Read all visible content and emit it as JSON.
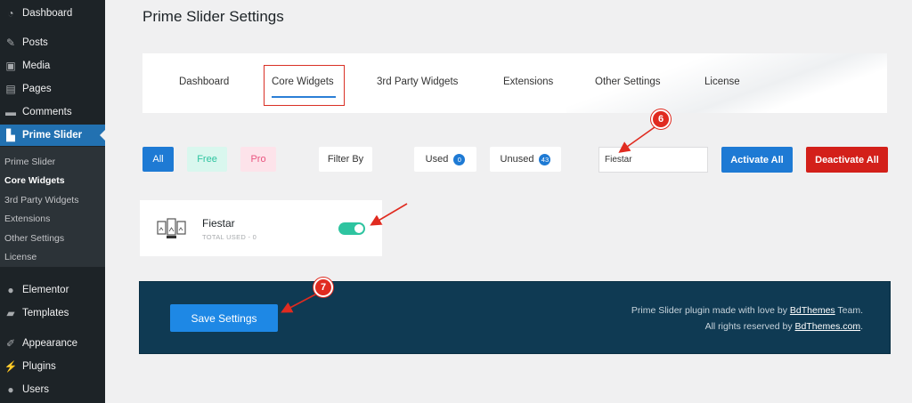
{
  "sidebar": {
    "items": [
      {
        "label": "Dashboard",
        "icon": "dashboard-icon"
      },
      {
        "label": "Posts",
        "icon": "pin-icon"
      },
      {
        "label": "Media",
        "icon": "media-icon"
      },
      {
        "label": "Pages",
        "icon": "pages-icon"
      },
      {
        "label": "Comments",
        "icon": "comment-icon"
      },
      {
        "label": "Prime Slider",
        "icon": "prime-slider-icon"
      },
      {
        "label": "Elementor",
        "icon": "elementor-icon"
      },
      {
        "label": "Templates",
        "icon": "folder-icon"
      },
      {
        "label": "Appearance",
        "icon": "brush-icon"
      },
      {
        "label": "Plugins",
        "icon": "plug-icon"
      },
      {
        "label": "Users",
        "icon": "user-icon"
      }
    ],
    "submenu": [
      "Prime Slider",
      "Core Widgets",
      "3rd Party Widgets",
      "Extensions",
      "Other Settings",
      "License"
    ]
  },
  "page": {
    "title": "Prime Slider Settings"
  },
  "tabs": [
    "Dashboard",
    "Core Widgets",
    "3rd Party Widgets",
    "Extensions",
    "Other Settings",
    "License"
  ],
  "filters": {
    "all": "All",
    "free": "Free",
    "pro": "Pro",
    "filter_by": "Filter By",
    "used": "Used",
    "used_count": "0",
    "unused": "Unused",
    "unused_count": "43"
  },
  "search": {
    "value": "Fiestar"
  },
  "actions": {
    "activate_all": "Activate All",
    "deactivate_all": "Deactivate All"
  },
  "widget": {
    "name": "Fiestar",
    "meta": "TOTAL USED - 0",
    "enabled": true
  },
  "footer": {
    "save": "Save Settings",
    "credit_prefix": "Prime Slider plugin made with love by",
    "credit_brand": "BdThemes",
    "credit_suffix": "Team.",
    "rights_prefix": "All rights reserved by",
    "rights_link": "BdThemes.com",
    "rights_suffix": "."
  },
  "annotations": [
    "6",
    "7"
  ],
  "colors": {
    "accent": "#1e7ad4",
    "danger": "#d3201a",
    "toggle_on": "#2ec4a0",
    "footer_bg": "#0f3a53",
    "callout": "#e02b20"
  }
}
